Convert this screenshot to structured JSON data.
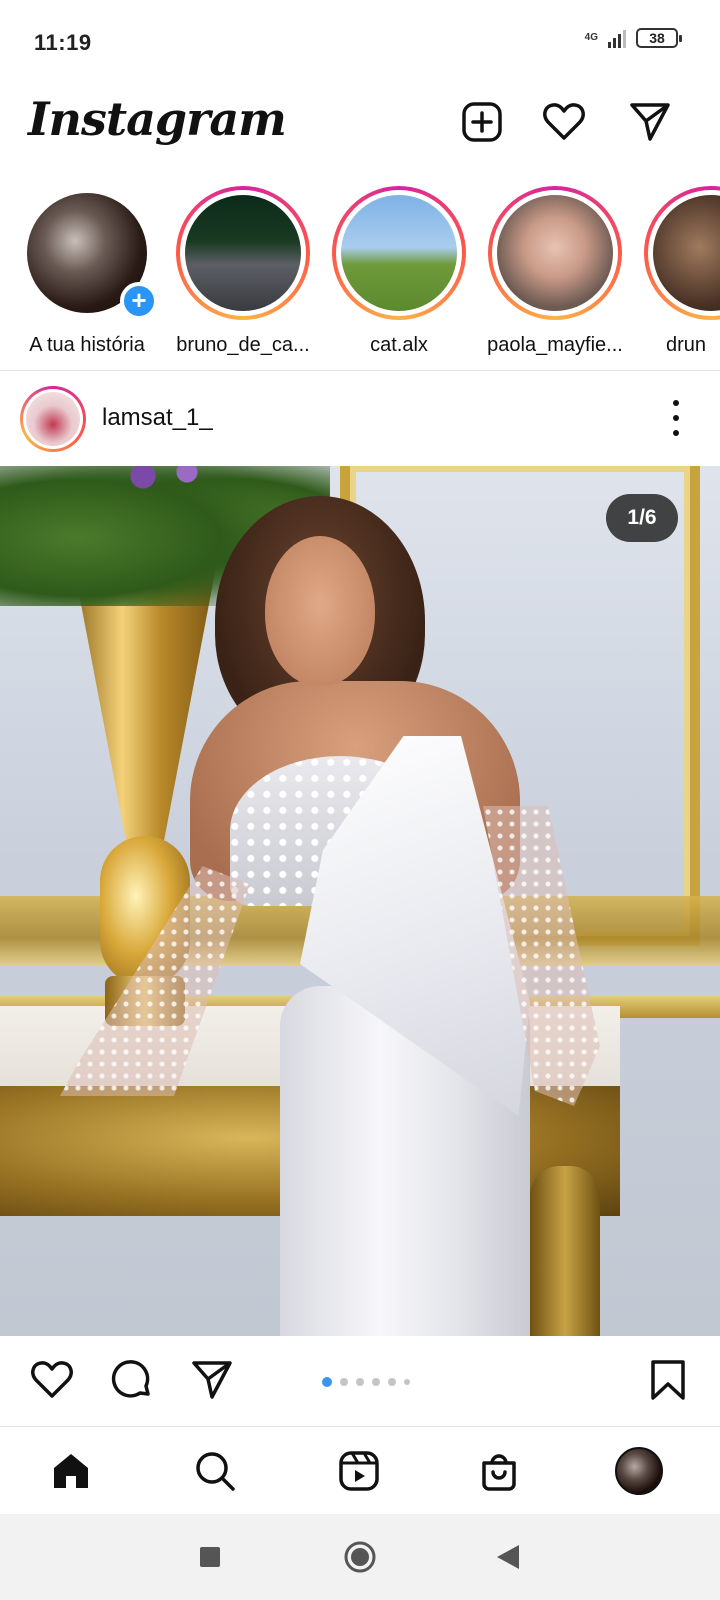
{
  "status_bar": {
    "time": "11:19",
    "network": "4G",
    "battery": "38"
  },
  "app_bar": {
    "logo": "Instagram",
    "icons": [
      "new-post-icon",
      "heart-icon",
      "direct-message-icon"
    ]
  },
  "stories": [
    {
      "label": "A tua história",
      "own": true
    },
    {
      "label": "bruno_de_ca..."
    },
    {
      "label": "cat.alx"
    },
    {
      "label": "paola_mayfie..."
    },
    {
      "label": "drun"
    }
  ],
  "post": {
    "username": "lamsat_1_",
    "image_counter": "1/6",
    "carousel_dots": 6,
    "active_dot": 0
  },
  "actions": {
    "icons": [
      "like-icon",
      "comment-icon",
      "share-icon",
      "save-icon"
    ]
  },
  "bottom_nav": {
    "items": [
      "home-icon",
      "search-icon",
      "reels-icon",
      "shop-icon",
      "profile-avatar"
    ]
  },
  "system_nav": {
    "buttons": [
      "recents-button",
      "home-button",
      "back-button"
    ]
  },
  "colors": {
    "accent_blue": "#3797f0",
    "story_ring_start": "#d6249f",
    "story_ring_end": "#fdb347",
    "text": "#111111"
  }
}
